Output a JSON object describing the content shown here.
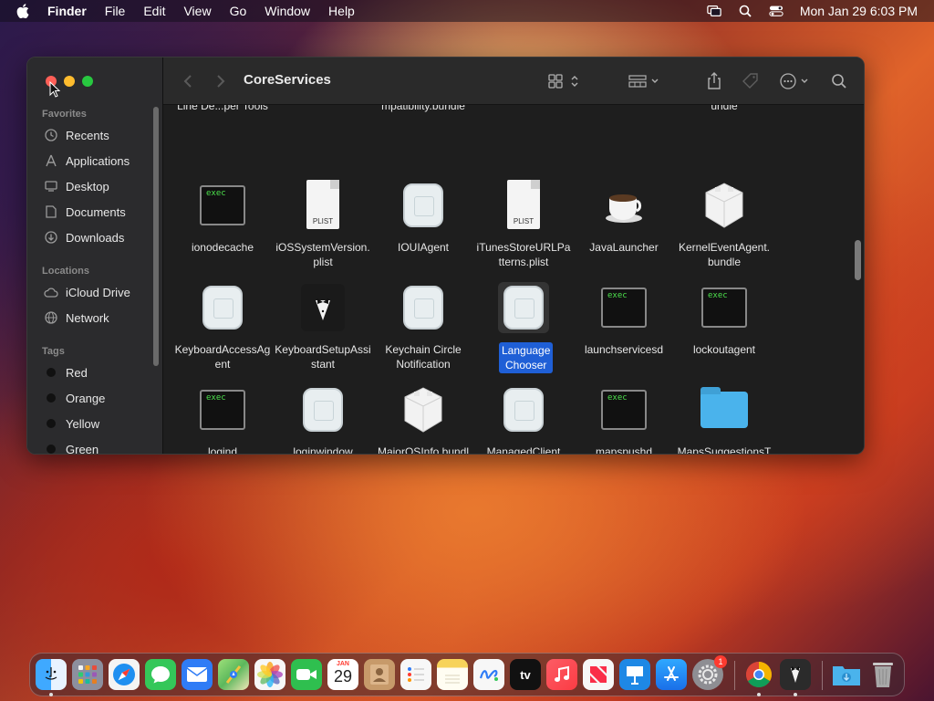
{
  "menubar": {
    "app_name": "Finder",
    "items": [
      "File",
      "Edit",
      "View",
      "Go",
      "Window",
      "Help"
    ],
    "clock": "Mon Jan 29  6:03 PM"
  },
  "window": {
    "title": "CoreServices",
    "sidebar": {
      "favorites_header": "Favorites",
      "favorites": [
        {
          "label": "Recents",
          "icon": "clock-icon"
        },
        {
          "label": "Applications",
          "icon": "applications-icon"
        },
        {
          "label": "Desktop",
          "icon": "desktop-icon"
        },
        {
          "label": "Documents",
          "icon": "document-icon"
        },
        {
          "label": "Downloads",
          "icon": "download-icon"
        }
      ],
      "locations_header": "Locations",
      "locations": [
        {
          "label": "iCloud Drive",
          "icon": "cloud-icon"
        },
        {
          "label": "Network",
          "icon": "globe-icon"
        }
      ],
      "tags_header": "Tags",
      "tags": [
        {
          "label": "Red"
        },
        {
          "label": "Orange"
        },
        {
          "label": "Yellow"
        },
        {
          "label": "Green"
        }
      ]
    },
    "partial_top_labels": [
      "Line De...per Tools",
      "mpatibility.bundle",
      "undle"
    ],
    "rows": [
      [
        {
          "label": "ionodecache",
          "kind": "exec"
        },
        {
          "label": "iOSSystemVersion.plist",
          "kind": "plist"
        },
        {
          "label": "IOUIAgent",
          "kind": "bundle"
        },
        {
          "label": "iTunesStoreURLPatterns.plist",
          "kind": "plist"
        },
        {
          "label": "JavaLauncher",
          "kind": "cup"
        },
        {
          "label": "KernelEventAgent.bundle",
          "kind": "lego"
        }
      ],
      [
        {
          "label": "KeyboardAccessAgent",
          "kind": "bundle"
        },
        {
          "label": "KeyboardSetupAssistant",
          "kind": "tux"
        },
        {
          "label": "Keychain Circle Notification",
          "kind": "bundle"
        },
        {
          "label": "Language Chooser",
          "kind": "bundle",
          "selected": true
        },
        {
          "label": "launchservicesd",
          "kind": "exec"
        },
        {
          "label": "lockoutagent",
          "kind": "exec"
        }
      ],
      [
        {
          "label": "logind",
          "kind": "exec"
        },
        {
          "label": "loginwindow",
          "kind": "bundle"
        },
        {
          "label": "MajorOSInfo.bundle",
          "kind": "lego"
        },
        {
          "label": "ManagedClient",
          "kind": "bundle"
        },
        {
          "label": "mapspushd",
          "kind": "exec"
        },
        {
          "label": "MapsSuggestionsTranspo...lmodelc",
          "kind": "folder"
        }
      ]
    ],
    "exec_text": "exec",
    "plist_text": "PLIST"
  },
  "dock": {
    "badge_count": "1",
    "calendar_month": "JAN",
    "calendar_day": "29",
    "tv_label": "tv",
    "apps": [
      {
        "name": "finder-icon",
        "color": "#2d8cf0"
      },
      {
        "name": "launchpad-icon",
        "color": "#8a8a9a"
      },
      {
        "name": "safari-icon",
        "color": "#2a9df4"
      },
      {
        "name": "messages-icon",
        "color": "#34c759"
      },
      {
        "name": "mail-icon",
        "color": "#2f7cf6"
      },
      {
        "name": "maps-icon",
        "color": "#5cb85c"
      },
      {
        "name": "photos-icon",
        "color": "#f4f4f4"
      },
      {
        "name": "facetime-icon",
        "color": "#2fbf4f"
      },
      {
        "name": "calendar-icon",
        "color": "#ffffff"
      },
      {
        "name": "contacts-icon",
        "color": "#c79a6a"
      },
      {
        "name": "reminders-icon",
        "color": "#f4f4f4"
      },
      {
        "name": "notes-icon",
        "color": "#f7d35a"
      },
      {
        "name": "freeform-icon",
        "color": "#f4f4f4"
      },
      {
        "name": "tv-icon",
        "color": "#111111"
      },
      {
        "name": "music-icon",
        "color": "#fc3c44"
      },
      {
        "name": "news-icon",
        "color": "#f4f4f4"
      },
      {
        "name": "keynote-icon",
        "color": "#1e88e5"
      },
      {
        "name": "app-store-icon",
        "color": "#1a8cf0"
      },
      {
        "name": "system-settings-icon",
        "color": "#8e8e93"
      },
      {
        "name": "chrome-icon",
        "color": "#f4f4f4"
      },
      {
        "name": "tuxedo-icon",
        "color": "#2b2b2b"
      },
      {
        "name": "downloads-folder-icon",
        "color": "#4ab3ec"
      },
      {
        "name": "trash-icon",
        "color": "#9a9a9a"
      }
    ]
  }
}
